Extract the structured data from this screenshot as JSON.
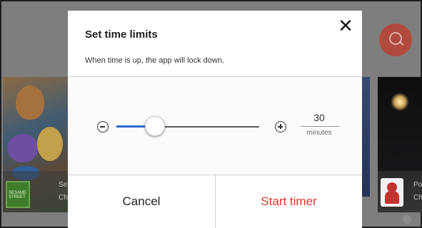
{
  "dialog": {
    "title": "Set time limits",
    "subtitle": "When time is up, the app will lock down.",
    "close_icon": "close-icon",
    "slider": {
      "value_fraction": 0.27,
      "minus_icon": "minus-circle-icon",
      "plus_icon": "plus-circle-icon",
      "accent_color": "#2a6bd1"
    },
    "value": "30",
    "unit": "minutes",
    "buttons": {
      "cancel_label": "Cancel",
      "start_label": "Start timer",
      "start_color": "#e5352a"
    }
  },
  "background": {
    "search_icon": "search-icon",
    "left_card": {
      "logo_text": "SESAME STREET",
      "caption_lines": [
        "Se",
        "Ch"
      ]
    },
    "right_card": {
      "caption_lines": [
        "Po",
        "Ch"
      ]
    }
  }
}
